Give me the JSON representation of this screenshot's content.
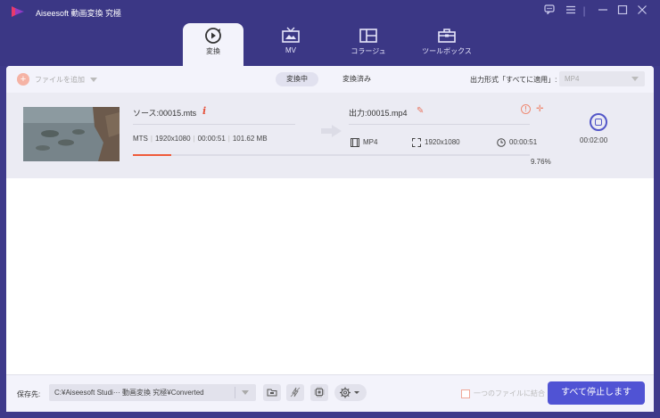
{
  "app": {
    "title": "Aiseesoft 動画変換 究極"
  },
  "window_controls": [
    "feedback-icon",
    "menu-icon",
    "minimize-icon",
    "maximize-icon",
    "close-icon"
  ],
  "nav": {
    "tabs": [
      {
        "label": "変換",
        "icon": "convert-icon",
        "active": true
      },
      {
        "label": "MV",
        "icon": "tv-icon",
        "active": false
      },
      {
        "label": "コラージュ",
        "icon": "collage-icon",
        "active": false
      },
      {
        "label": "ツールボックス",
        "icon": "toolbox-icon",
        "active": false
      }
    ]
  },
  "toolbar": {
    "add_file_label": "ファイルを追加",
    "status_tabs": [
      {
        "label": "変換中",
        "active": true
      },
      {
        "label": "変換済み",
        "active": false
      }
    ],
    "output_format_label": "出力形式「すべてに適用」:",
    "output_format_value": "MP4"
  },
  "item": {
    "source_name": "ソース:00015.mts",
    "source_meta": [
      "MTS",
      "1920x1080",
      "00:00:51",
      "101.62 MB"
    ],
    "output_name": "出力:00015.mp4",
    "output_format": "MP4",
    "output_resolution": "1920x1080",
    "output_duration": "00:00:51",
    "progress_percent": "9.76%",
    "progress_value": 9.76,
    "remaining_time": "00:02:00"
  },
  "bottom": {
    "save_label": "保存先:",
    "save_path": "C:¥Aiseesoft Studi··· 動画変換 究極¥Converted",
    "merge_label": "一つのファイルに結合",
    "stop_all_label": "すべて停止します"
  },
  "colors": {
    "header_bg": "#3b3785",
    "accent": "#5053d4",
    "progress": "#ef5a39"
  }
}
